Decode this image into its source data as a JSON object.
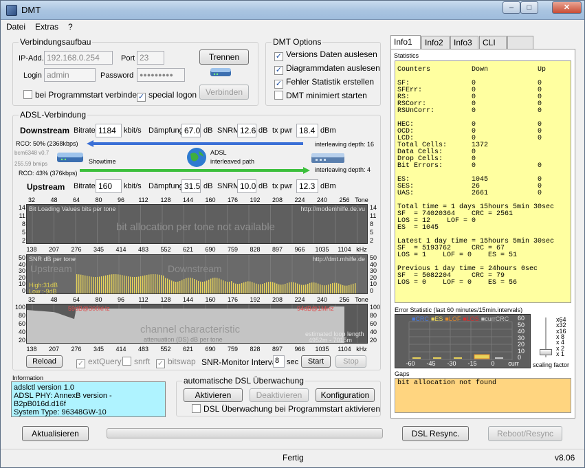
{
  "window": {
    "title": "DMT",
    "min": "–",
    "max": "□",
    "close": "✕"
  },
  "menu": [
    "Datei",
    "Extras",
    "?"
  ],
  "conn": {
    "title": "Verbindungsaufbau",
    "ip_label": "IP-Add.",
    "ip": "192.168.0.254",
    "port_label": "Port",
    "port": "23",
    "login_label": "Login",
    "login": "admin",
    "pwd_label": "Password",
    "pwd": "●●●●●●●●●",
    "trennen": "Trennen",
    "verbinden": "Verbinden",
    "auto": "bei Programmstart verbinden",
    "special": "special logon"
  },
  "opts": {
    "title": "DMT Options",
    "o1": "Versions Daten auslesen",
    "o2": "Diagrammdaten auslesen",
    "o3": "Fehler Statistik erstellen",
    "o4": "DMT minimiert starten"
  },
  "adsl": {
    "title": "ADSL-Verbindung",
    "down": "Downstream",
    "up": "Upstream",
    "bitrate": "Bitrate",
    "kbits": "kbit/s",
    "daempfung": "Dämpfung",
    "db": "dB",
    "snrm": "SNRM",
    "txpwr": "tx pwr",
    "dbm": "dBm",
    "down_bitrate": "1184",
    "down_att": "67.0",
    "down_snrm": "12.6",
    "down_tx": "18.4",
    "up_bitrate": "160",
    "up_att": "31.5",
    "up_snrm": "10.0",
    "up_tx": "12.3",
    "rco_down": "RCO: 50% (2368kbps)",
    "rco_up": "RCO: 43% (376kbps)",
    "chip": "bcm6348 v0.7",
    "rate": "255.59 bmips",
    "showtime": "Showtime",
    "adsl_label": "ADSL",
    "path": "interleaved path",
    "il_down": "interleaving depth: 16",
    "il_up": "interleaving depth: 4"
  },
  "charts": {
    "tones": [
      "32",
      "48",
      "64",
      "80",
      "96",
      "112",
      "128",
      "144",
      "160",
      "176",
      "192",
      "208",
      "224",
      "240",
      "256",
      "Tone"
    ],
    "khz": [
      "138",
      "207",
      "276",
      "345",
      "414",
      "483",
      "552",
      "621",
      "690",
      "759",
      "828",
      "897",
      "966",
      "1035",
      "1104",
      "kHz"
    ],
    "bits_title": "Bit Loading Values   bits per tone",
    "bits_url": "http://modemhilfe.de.vu",
    "bits_msg": "bit allocation per tone not available",
    "bits_y": [
      "14",
      "11",
      "8",
      "5",
      "2"
    ],
    "snr_title": "SNR  dB per tone",
    "snr_url": "http://dmt.mhilfe.de",
    "snr_up": "Upstream",
    "snr_down": "Downstream",
    "snr_high": "High:31dB",
    "snr_low": "Low :-9dB",
    "snr_y": [
      "50",
      "40",
      "30",
      "20",
      "10",
      "0"
    ],
    "ch_left": "59dB@300kHz",
    "ch_right": "94dB@1MHz",
    "ch_title": "channel characteristic",
    "ch_sub": "attenuation (DS)  dB per tone",
    "ch_est": "estimated loop length",
    "ch_len": "4952m - 7015m",
    "ch_y": [
      "100",
      "80",
      "60",
      "40",
      "20"
    ]
  },
  "ctrl": {
    "reload": "Reload",
    "extquery": "extQuery",
    "snrft": "snrft",
    "bitswap": "bitswap",
    "snrmon": "SNR-Monitor Interval:",
    "interval": "8",
    "sec": "sec",
    "start": "Start",
    "stop": "Stop"
  },
  "info": {
    "title": "Information",
    "l1": "adslctl version 1.0",
    "l2": "ADSL PHY: AnnexB version - B2pB016d.d16f",
    "l3": "System Type: 96348GW-10"
  },
  "auto": {
    "title": "automatische DSL Überwachung",
    "aktivieren": "Aktivieren",
    "deaktivieren": "Deaktivieren",
    "konfig": "Konfiguration",
    "start": "DSL Überwachung bei Programmstart aktivieren"
  },
  "bottom": {
    "aktualisieren": "Aktualisieren",
    "resync": "DSL Resync.",
    "reboot": "Reboot/Resync",
    "status": "Fertig",
    "version": "v8.06"
  },
  "tabs": [
    "Info1",
    "Info2",
    "Info3",
    "CLI"
  ],
  "stats": {
    "title": "Statistics",
    "text": "Counters          Down            Up\n\nSF:               0               0\nSFErr:            0               0\nRS:               0               0\nRSCorr:           0               0\nRSUnCorr:         0               0\n\nHEC:              0               0\nOCD:              0               0\nLCD:              0               0\nTotal Cells:      1372\nData Cells:       0\nDrop Cells:       0\nBit Errors:       0               0\n\nES:               1045            0\nSES:              26              0\nUAS:              2661            0\n\nTotal time = 1 days 15hours 5min 30sec\nSF  = 74020364    CRC = 2561\nLOS = 12    LOF = 0\nES  = 1045\n\nLatest 1 day time = 15hours 5min 30sec\nSF  = 5193762     CRC = 67\nLOS = 1    LOF = 0    ES = 51\n\nPrevious 1 day time = 24hours 0sec\nSF  = 5082204     CRC = 79\nLOS = 0    LOF = 0    ES = 56"
  },
  "errstat": {
    "title": "Error Statistic (last 60 minutes/15min.intervals)",
    "legend": [
      "CRC",
      "ES",
      "LOF",
      "LOS",
      "currCRC"
    ],
    "y": [
      "60",
      "50",
      "40",
      "30",
      "20",
      "10",
      "0"
    ],
    "x": [
      "-60",
      "-45",
      "-30",
      "-15",
      "0",
      "curr"
    ],
    "scale": [
      "x64",
      "x32",
      "x16",
      "x 8",
      "x 4",
      "x 2",
      "x 1"
    ],
    "scaling": "scaling factor",
    "colors": {
      "CRC": "#4c7bd8",
      "ES": "#e8d25a",
      "LOF": "#e38a2c",
      "LOS": "#d83030",
      "currCRC": "#c8c8c8"
    }
  },
  "gaps": {
    "title": "Gaps",
    "text": "bit allocation not found"
  }
}
